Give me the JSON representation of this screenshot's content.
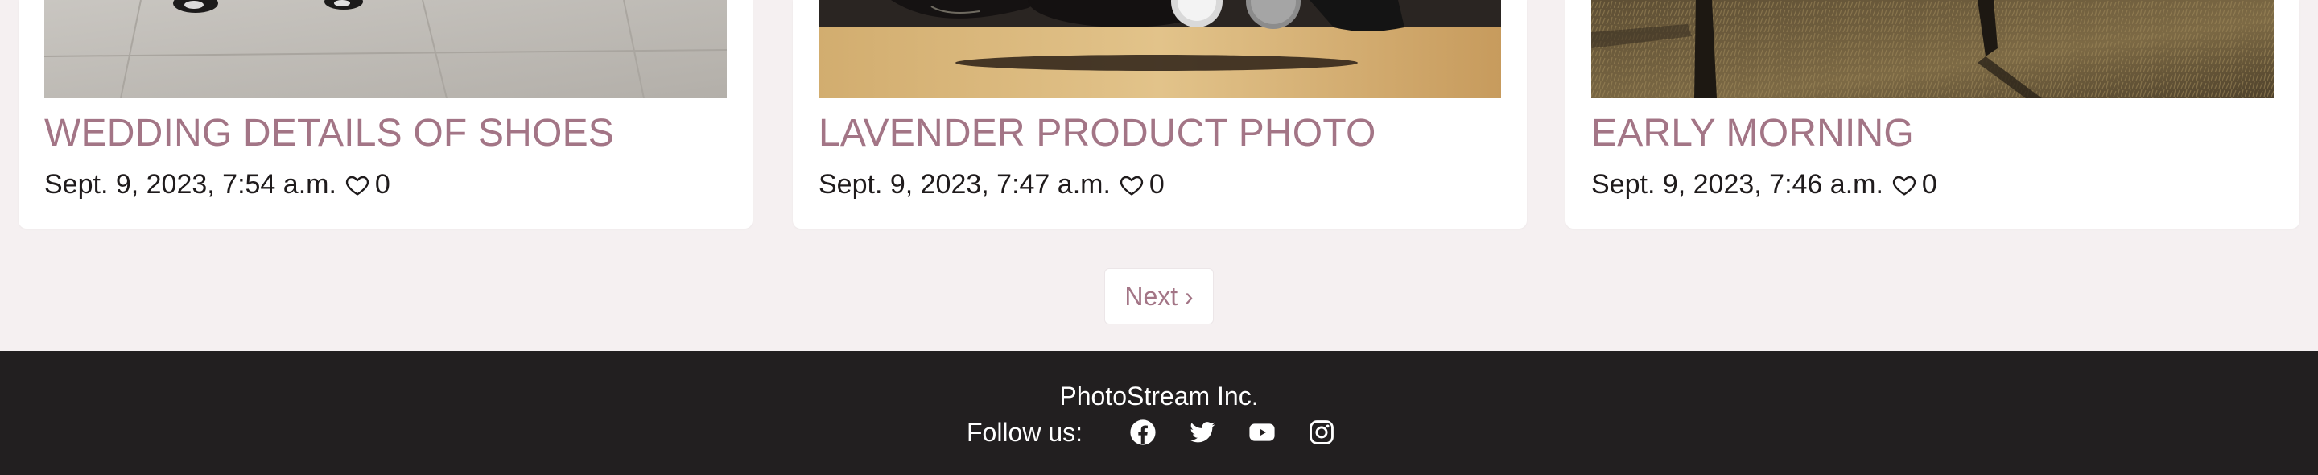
{
  "cards": [
    {
      "title": "WEDDING DETAILS OF SHOES",
      "date": "Sept. 9, 2023, 7:54 a.m.",
      "likes": "0",
      "image": "wedding-shoes-photo"
    },
    {
      "title": "LAVENDER PRODUCT PHOTO",
      "date": "Sept. 9, 2023, 7:47 a.m.",
      "likes": "0",
      "image": "lavender-product-photo"
    },
    {
      "title": "EARLY MORNING",
      "date": "Sept. 9, 2023, 7:46 a.m.",
      "likes": "0",
      "image": "early-morning-photo"
    }
  ],
  "pagination": {
    "next_label": "Next ›"
  },
  "footer": {
    "company": "PhotoStream Inc.",
    "follow_label": "Follow us:",
    "social_icons": [
      "facebook-icon",
      "twitter-icon",
      "youtube-icon",
      "instagram-icon"
    ]
  },
  "colors": {
    "accent": "#a37586",
    "background": "#f5f0f1",
    "footer_bg": "#221f20",
    "card_bg": "#ffffff",
    "text": "#1f1b1c"
  }
}
